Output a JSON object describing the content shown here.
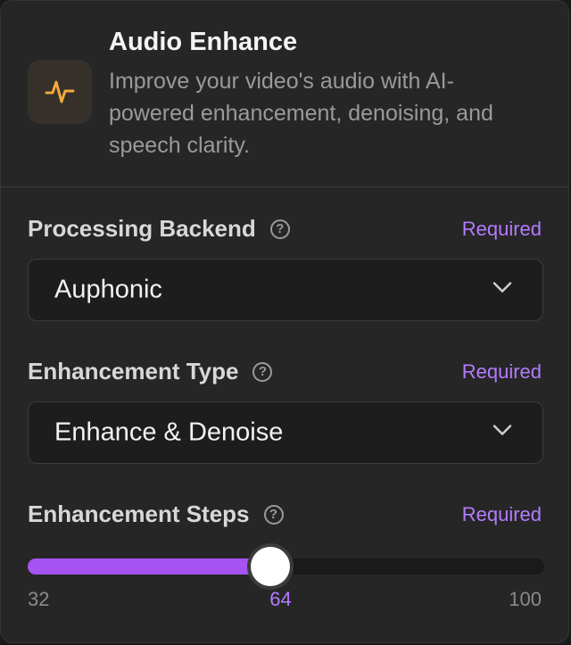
{
  "header": {
    "icon": "audio-waveform-icon",
    "title": "Audio Enhance",
    "description": "Improve your video's audio with AI-powered enhancement, denoising, and speech clarity."
  },
  "fields": {
    "backend": {
      "label": "Processing Backend",
      "required": "Required",
      "value": "Auphonic"
    },
    "type": {
      "label": "Enhancement Type",
      "required": "Required",
      "value": "Enhance & Denoise"
    },
    "steps": {
      "label": "Enhancement Steps",
      "required": "Required",
      "min": "32",
      "max": "100",
      "value": "64"
    }
  },
  "colors": {
    "accent": "#a653f2",
    "required": "#b57bff",
    "icon": "#f2a93b"
  },
  "help_icon": "?"
}
